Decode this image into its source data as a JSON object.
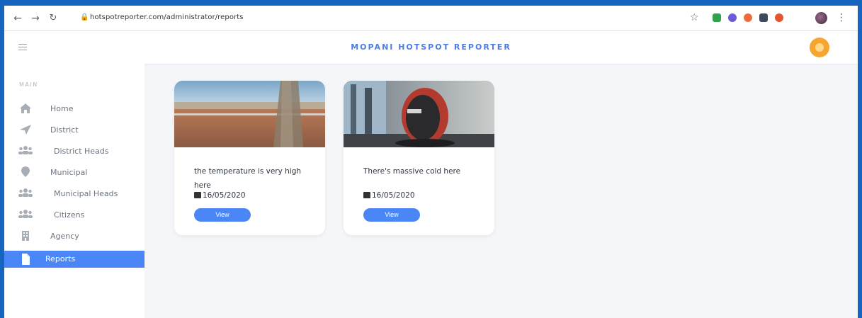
{
  "browser": {
    "url": "hotspotreporter.com/administrator/reports",
    "extensions": [
      "ext-green",
      "ext-purple",
      "ext-orange",
      "ext-dark",
      "ext-red"
    ]
  },
  "header": {
    "title": "MOPANI HOTSPOT REPORTER"
  },
  "sidebar": {
    "heading": "MAIN",
    "items": [
      {
        "label": "Home",
        "icon": "home-icon"
      },
      {
        "label": "District",
        "icon": "location-arrow-icon"
      },
      {
        "label": "District Heads",
        "icon": "users-icon"
      },
      {
        "label": "Municipal",
        "icon": "map-marker-icon"
      },
      {
        "label": "Municipal Heads",
        "icon": "users-icon"
      },
      {
        "label": "Citizens",
        "icon": "users-icon"
      },
      {
        "label": "Agency",
        "icon": "building-icon"
      },
      {
        "label": "Reports",
        "icon": "file-icon",
        "active": true
      }
    ]
  },
  "reports": [
    {
      "description": "the temperature is very high here",
      "date": "16/05/2020",
      "button": "View"
    },
    {
      "description": "There's massive cold here",
      "date": "16/05/2020",
      "button": "View"
    }
  ],
  "colors": {
    "accent": "#4a86f5",
    "brand": "#4c7ce8",
    "page_background": "#f4f6f9"
  }
}
